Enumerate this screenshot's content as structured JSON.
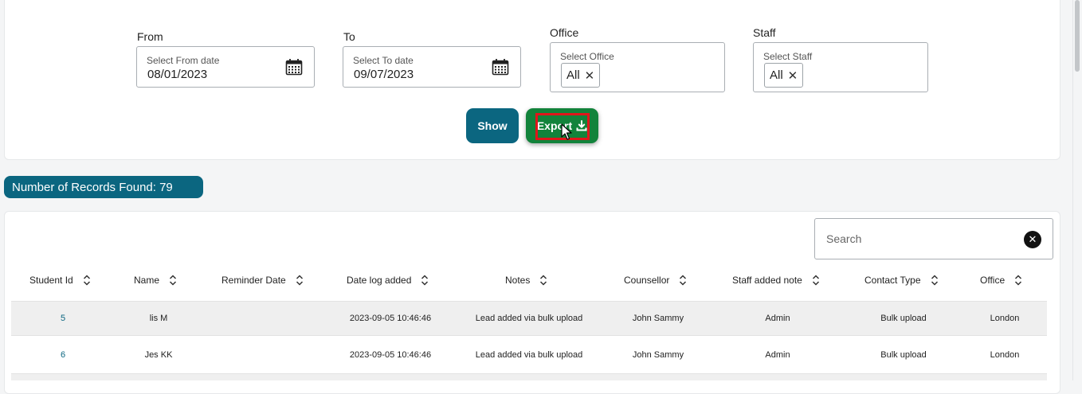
{
  "filters": {
    "from": {
      "label": "From",
      "sublabel": "Select From date",
      "value": "08/01/2023"
    },
    "to": {
      "label": "To",
      "sublabel": "Select To date",
      "value": "09/07/2023"
    },
    "office": {
      "label": "Office",
      "sublabel": "Select Office",
      "chip": "All"
    },
    "staff": {
      "label": "Staff",
      "sublabel": "Select Staff",
      "chip": "All"
    }
  },
  "actions": {
    "show_label": "Show",
    "export_label": "Export"
  },
  "records": {
    "text": "Number of Records Found: 79"
  },
  "search": {
    "placeholder": "Search"
  },
  "table": {
    "headers": [
      "Student Id",
      "Name",
      "Reminder Date",
      "Date log added",
      "Notes",
      "Counsellor",
      "Staff added note",
      "Contact Type",
      "Office"
    ],
    "rows": [
      {
        "student_id": "5",
        "name": "lis M",
        "reminder_date": "",
        "date_log_added": "2023-09-05 10:46:46",
        "notes": "Lead added via bulk upload",
        "counsellor": "John Sammy",
        "staff_added_note": "Admin",
        "contact_type": "Bulk upload",
        "office": "London"
      },
      {
        "student_id": "6",
        "name": "Jes KK",
        "reminder_date": "",
        "date_log_added": "2023-09-05 10:46:46",
        "notes": "Lead added via bulk upload",
        "counsellor": "John Sammy",
        "staff_added_note": "Admin",
        "contact_type": "Bulk upload",
        "office": "London"
      }
    ]
  },
  "colors": {
    "primary": "#0b6680",
    "export_green": "#12833b",
    "highlight": "#e0161b"
  }
}
